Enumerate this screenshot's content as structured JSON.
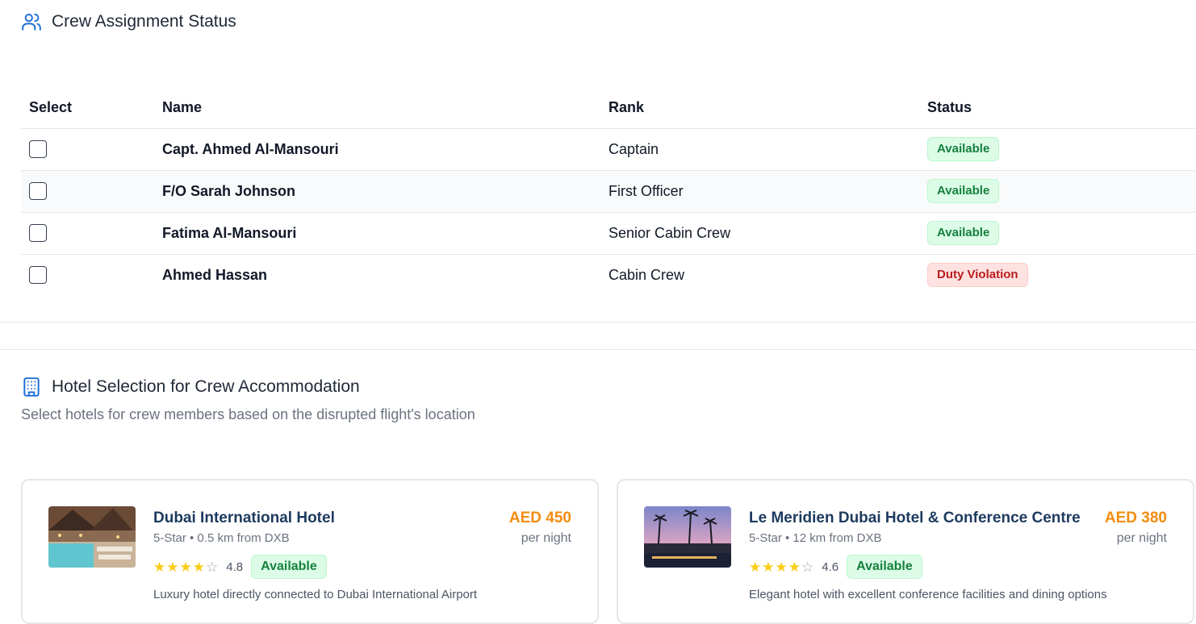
{
  "crew_section": {
    "title": "Crew Assignment Status",
    "columns": [
      "Select",
      "Name",
      "Rank",
      "Status"
    ],
    "rows": [
      {
        "name": "Capt. Ahmed Al-Mansouri",
        "rank": "Captain",
        "status": "Available",
        "status_type": "ok"
      },
      {
        "name": "F/O Sarah Johnson",
        "rank": "First Officer",
        "status": "Available",
        "status_type": "ok"
      },
      {
        "name": "Fatima Al-Mansouri",
        "rank": "Senior Cabin Crew",
        "status": "Available",
        "status_type": "ok"
      },
      {
        "name": "Ahmed Hassan",
        "rank": "Cabin Crew",
        "status": "Duty Violation",
        "status_type": "violation"
      }
    ]
  },
  "hotel_section": {
    "title": "Hotel Selection for Crew Accommodation",
    "subtitle": "Select hotels for crew members based on the disrupted flight's location",
    "hotels": [
      {
        "name": "Dubai International Hotel",
        "meta": "5-Star • 0.5 km from DXB",
        "price": "AED 450",
        "per": "per night",
        "stars": 4,
        "rating": "4.8",
        "status": "Available",
        "description": "Luxury hotel directly connected to Dubai International Airport"
      },
      {
        "name": "Le Meridien Dubai Hotel & Conference Centre",
        "meta": "5-Star • 12 km from DXB",
        "price": "AED 380",
        "per": "per night",
        "stars": 4,
        "rating": "4.6",
        "status": "Available",
        "description": "Elegant hotel with excellent conference facilities and dining options"
      }
    ]
  },
  "colors": {
    "accent_blue": "#1d6fd8",
    "price_orange": "#f28c0f",
    "available_green": "#15803d",
    "violation_red": "#b91c1c",
    "star_yellow": "#facc15"
  },
  "icons": {
    "crew_title": "users-icon",
    "hotel_title": "building-icon",
    "star": "star-icon"
  }
}
